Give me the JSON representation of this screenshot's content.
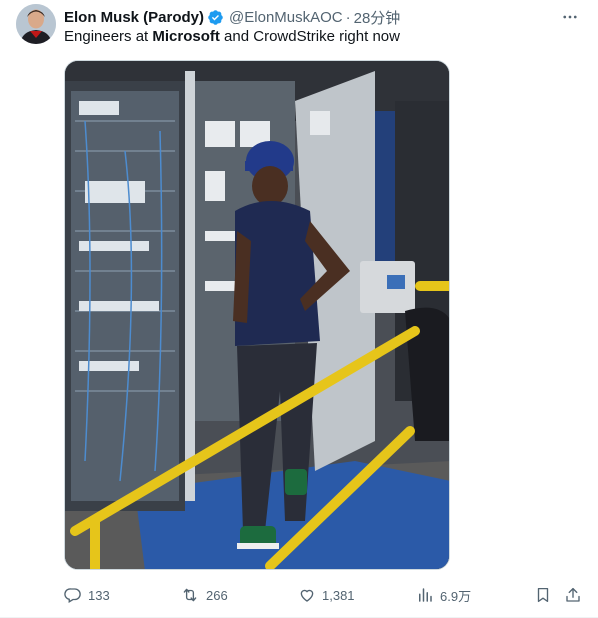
{
  "tweet": {
    "display_name": "Elon Musk (Parody)",
    "handle": "@ElonMuskAOC",
    "separator": "·",
    "time": "28分钟",
    "text_before": "Engineers at ",
    "text_bold": "Microsoft",
    "text_after": " and CrowdStrike right now"
  },
  "actions": {
    "replies": "133",
    "reposts": "266",
    "likes": "1,381",
    "views": "6.9万"
  },
  "colors": {
    "verified": "#1d9bf0",
    "text_primary": "#0f1419",
    "text_secondary": "#536471"
  },
  "icons": [
    "verified-badge-icon",
    "more-options-icon",
    "reply-icon",
    "repost-icon",
    "like-icon",
    "views-icon",
    "bookmark-icon",
    "share-icon"
  ]
}
